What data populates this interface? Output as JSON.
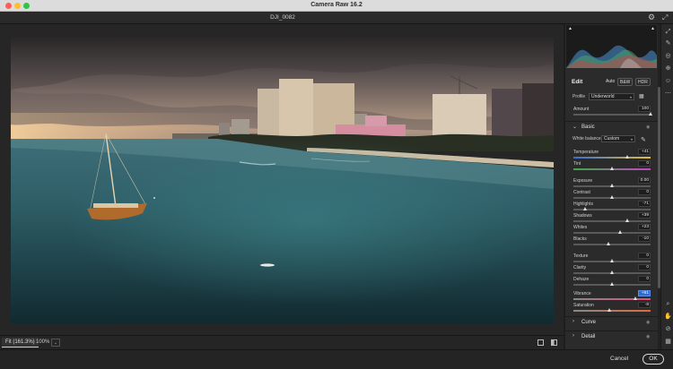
{
  "window": {
    "title": "Camera Raw 16.2",
    "filename": "DJI_0082"
  },
  "canvas": {
    "zoom_fit": "Fit (161.3%)",
    "zoom_100": "100%",
    "zoom_dropdown": "⌄"
  },
  "footer": {
    "cancel": "Cancel",
    "ok": "OK"
  },
  "histogram": {
    "clip_shadow": "▲",
    "clip_highlight": "▲"
  },
  "edit": {
    "title": "Edit",
    "auto": "Auto",
    "bw": "B&W",
    "hdr": "HDR",
    "profile_label": "Profile",
    "profile_value": "Underworld",
    "amount_label": "Amount",
    "amount_value": "100",
    "amount_fraction": 1.0
  },
  "basic": {
    "title": "Basic",
    "chev": "⌄",
    "eye": "◉",
    "wb_label": "White balance",
    "wb_value": "Custom",
    "picker": "✎",
    "sliders": [
      {
        "label": "Temperature",
        "value": "+41",
        "pos": 0.7,
        "track": "temp"
      },
      {
        "label": "Tint",
        "value": "0",
        "pos": 0.5,
        "track": "tint"
      },
      {
        "label": "Exposure",
        "value": "0.00",
        "pos": 0.5
      },
      {
        "label": "Contrast",
        "value": "0",
        "pos": 0.5
      },
      {
        "label": "Highlights",
        "value": "-71",
        "pos": 0.15
      },
      {
        "label": "Shadows",
        "value": "+39",
        "pos": 0.7
      },
      {
        "label": "Whites",
        "value": "+23",
        "pos": 0.61
      },
      {
        "label": "Blacks",
        "value": "-10",
        "pos": 0.45
      },
      {
        "label": "Texture",
        "value": "0",
        "pos": 0.5
      },
      {
        "label": "Clarity",
        "value": "0",
        "pos": 0.5
      },
      {
        "label": "Dehaze",
        "value": "0",
        "pos": 0.5
      },
      {
        "label": "Vibrance",
        "value": "+61",
        "pos": 0.8,
        "highlight": true,
        "track": "vib"
      },
      {
        "label": "Saturation",
        "value": "-8",
        "pos": 0.46,
        "track": "sat"
      }
    ]
  },
  "sections": [
    {
      "title": "Curve",
      "chev": "›",
      "eye": "◉"
    },
    {
      "title": "Detail",
      "chev": "›",
      "eye": "◉"
    }
  ],
  "tools": [
    "⤢",
    "✎",
    "◎",
    "⊕",
    "☺",
    "⋯",
    "⌕",
    "✋",
    "⊘",
    "▦"
  ]
}
